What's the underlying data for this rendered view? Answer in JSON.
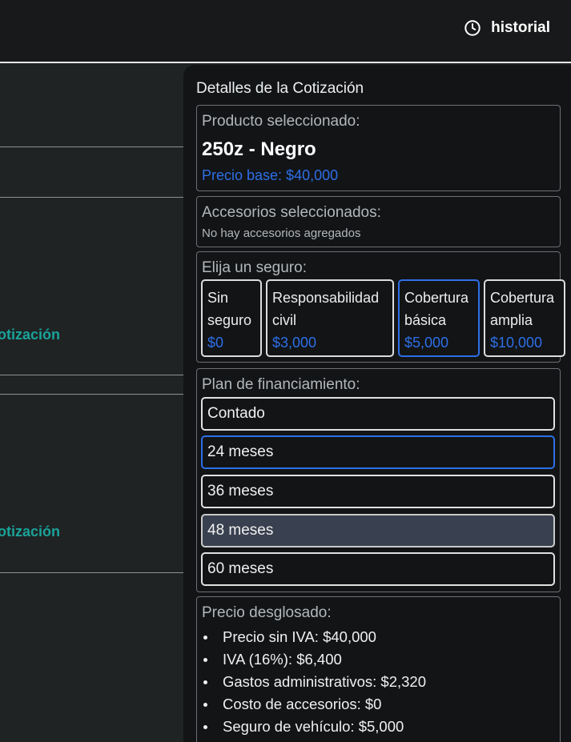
{
  "header": {
    "history_label": "historial"
  },
  "left": {
    "links": [
      "otización",
      "otización"
    ]
  },
  "panel": {
    "title": "Detalles de la Cotización",
    "product": {
      "label": "Producto seleccionado:",
      "name": "250z - Negro",
      "base_price": "Precio base: $40,000"
    },
    "accessories": {
      "label": "Accesorios seleccionados:",
      "empty_text": "No hay accesorios agregados"
    },
    "insurance": {
      "label": "Elija un seguro:",
      "options": [
        {
          "line1": "Sin",
          "line2": "seguro",
          "price": "$0"
        },
        {
          "line1": "Responsabilidad",
          "line2": "civil",
          "price": "$3,000"
        },
        {
          "line1": "Cobertura",
          "line2": "básica",
          "price": "$5,000"
        },
        {
          "line1": "Cobertura",
          "line2": "amplia",
          "price": "$10,000"
        }
      ],
      "selected": "Cobertura básica"
    },
    "financing": {
      "label": "Plan de financiamiento:",
      "plans": [
        "Contado",
        "24 meses",
        "36 meses",
        "48 meses",
        "60 meses"
      ],
      "selected": "24 meses",
      "hovered": "48 meses"
    },
    "breakdown": {
      "label": "Precio desglosado:",
      "items": [
        "Precio sin IVA: $40,000",
        "IVA (16%): $6,400",
        "Gastos administrativos: $2,320",
        "Costo de accesorios: $0",
        "Seguro de vehículo: $5,000"
      ]
    }
  },
  "colors": {
    "accent_blue": "#2f6fe6",
    "link_teal": "#1aa39a",
    "background": "#1f2324",
    "panel_bg": "#121416",
    "hover_bg": "#394150"
  }
}
